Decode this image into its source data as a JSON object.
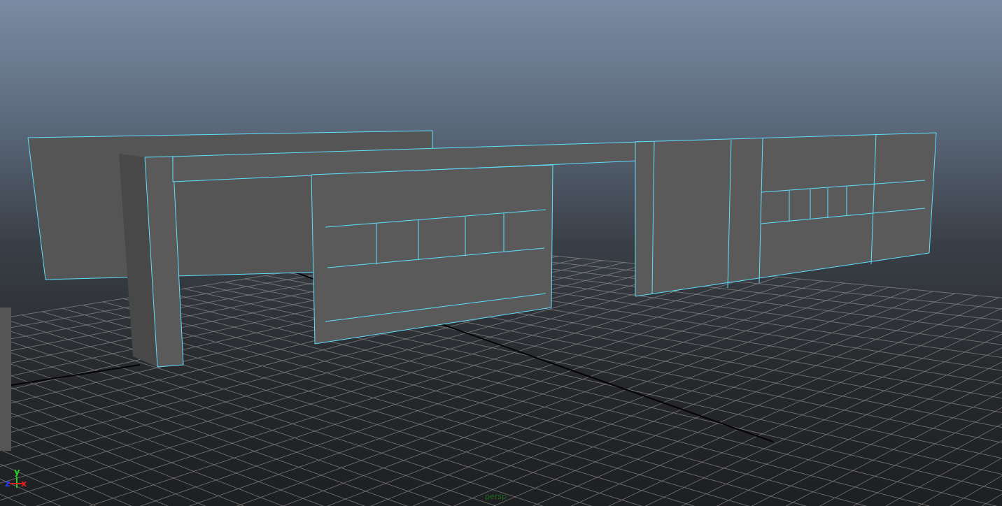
{
  "viewport": {
    "camera": "persp",
    "axes": [
      {
        "label": "y",
        "color": "#22d022"
      },
      {
        "label": "z",
        "color": "#2a3cff"
      },
      {
        "label": "x",
        "color": "#e02020"
      }
    ]
  }
}
